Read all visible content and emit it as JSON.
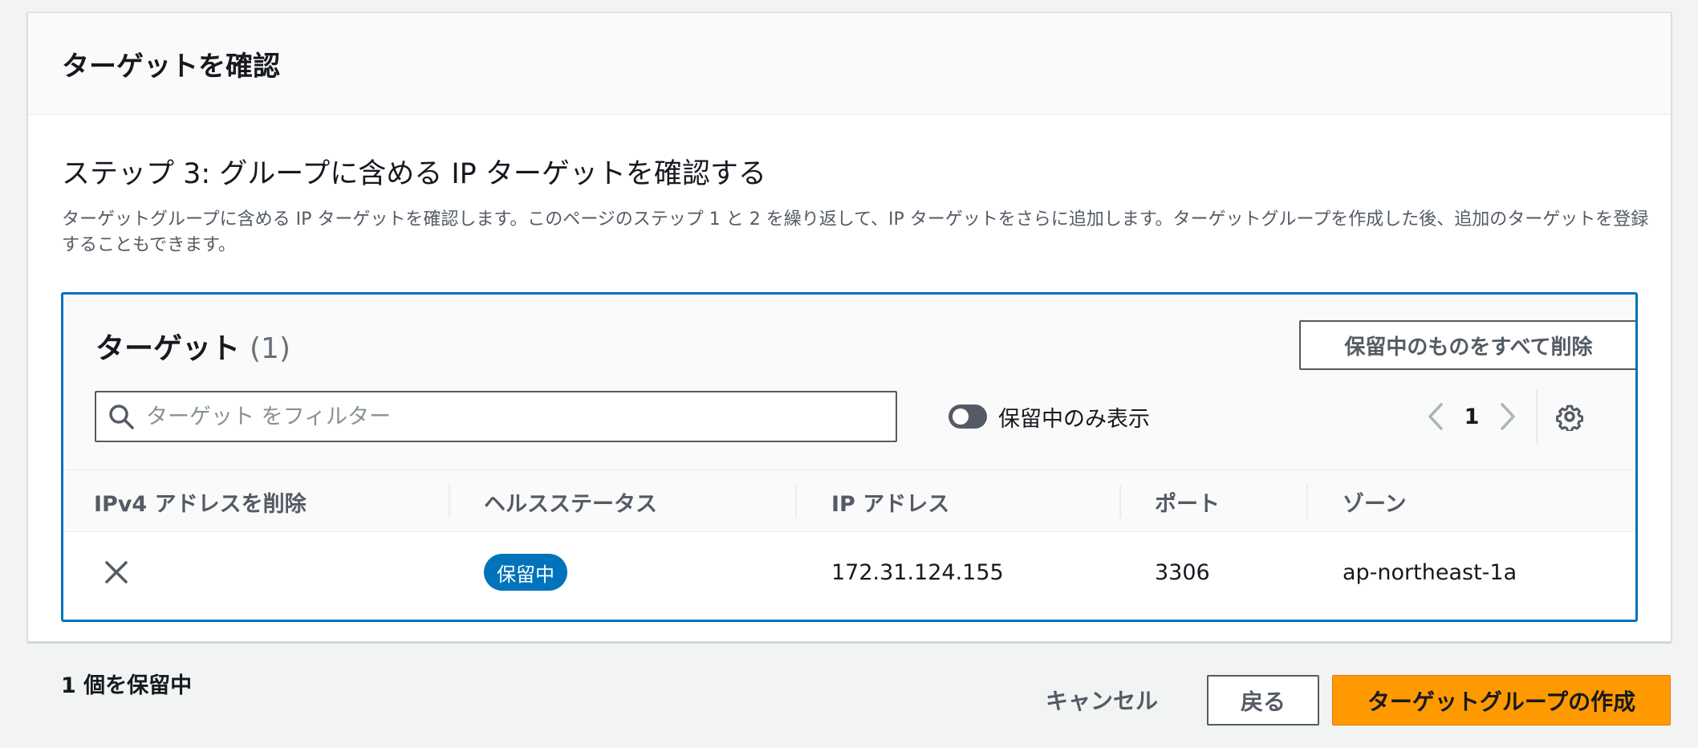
{
  "container": {
    "title": "ターゲットを確認"
  },
  "step": {
    "title": "ステップ 3: グループに含める IP ターゲットを確認する",
    "description": "ターゲットグループに含める IP ターゲットを確認します。このページのステップ 1 と 2 を繰り返して、IP ターゲットをさらに追加します。ターゲットグループを作成した後、追加のターゲットを登録することもできます。"
  },
  "targets": {
    "title": "ターゲット",
    "count": "(1)",
    "remove_all_label": "保留中のものをすべて削除",
    "filter_placeholder": "ターゲット をフィルター",
    "filter_value": "",
    "toggle_label": "保留中のみ表示",
    "toggle_on": false,
    "page": "1",
    "columns": [
      "IPv4 アドレスを削除",
      "ヘルスステータス",
      "IP アドレス",
      "ポート",
      "ゾーン"
    ],
    "rows": [
      {
        "remove_icon": "close-icon",
        "health_status": "保留中",
        "ip_address": "172.31.124.155",
        "port": "3306",
        "zone": "ap-northeast-1a"
      }
    ]
  },
  "footer": {
    "pending_text": "1 個を保留中",
    "cancel_label": "キャンセル",
    "back_label": "戻る",
    "create_label": "ターゲットグループの作成"
  },
  "colors": {
    "primary_button": "#ff9900",
    "panel_border": "#0073bb",
    "badge": "#0073bb"
  }
}
